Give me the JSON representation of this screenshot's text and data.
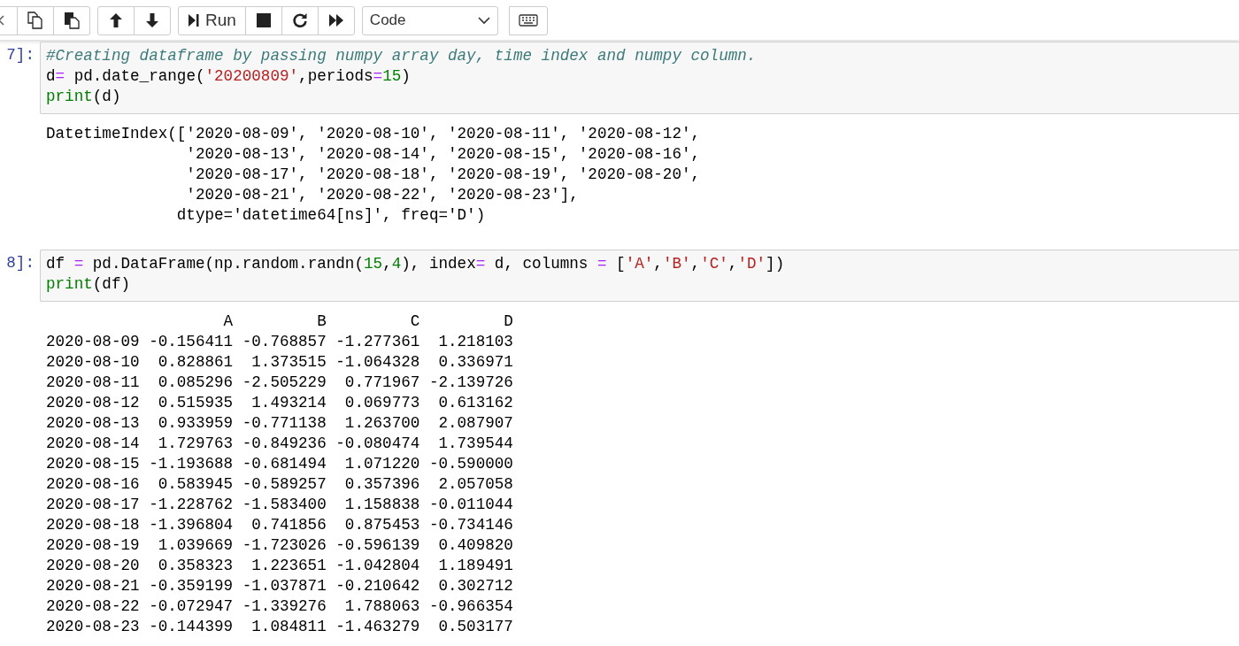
{
  "toolbar": {
    "groups": [
      [
        {
          "kind": "collapse"
        },
        {
          "kind": "copy"
        },
        {
          "kind": "paste"
        }
      ],
      [
        {
          "kind": "up"
        },
        {
          "kind": "down"
        }
      ],
      [
        {
          "kind": "run",
          "label": "Run"
        },
        {
          "kind": "stop"
        },
        {
          "kind": "restart"
        },
        {
          "kind": "fast-forward"
        }
      ]
    ],
    "cell_type": "Code",
    "extra": [
      {
        "kind": "keyboard"
      }
    ]
  },
  "cells": [
    {
      "prompt": "7]:",
      "code": [
        [
          {
            "kind": "comment",
            "text": "#Creating dataframe by passing numpy array day, time index and numpy column."
          }
        ],
        [
          {
            "kind": "plain",
            "text": "d"
          },
          {
            "kind": "op",
            "text": "="
          },
          {
            "kind": "plain",
            "text": " pd.date_range("
          },
          {
            "kind": "string",
            "text": "'20200809'"
          },
          {
            "kind": "plain",
            "text": ",periods"
          },
          {
            "kind": "op",
            "text": "="
          },
          {
            "kind": "number",
            "text": "15"
          },
          {
            "kind": "plain",
            "text": ")"
          }
        ],
        [
          {
            "kind": "builtin",
            "text": "print"
          },
          {
            "kind": "plain",
            "text": "(d)"
          }
        ]
      ],
      "output": [
        "DatetimeIndex(['2020-08-09', '2020-08-10', '2020-08-11', '2020-08-12',",
        "               '2020-08-13', '2020-08-14', '2020-08-15', '2020-08-16',",
        "               '2020-08-17', '2020-08-18', '2020-08-19', '2020-08-20',",
        "               '2020-08-21', '2020-08-22', '2020-08-23'],",
        "              dtype='datetime64[ns]', freq='D')"
      ]
    },
    {
      "prompt": "8]:",
      "code": [
        [
          {
            "kind": "plain",
            "text": "df "
          },
          {
            "kind": "op",
            "text": "="
          },
          {
            "kind": "plain",
            "text": " pd.DataFrame(np.random.randn("
          },
          {
            "kind": "number",
            "text": "15"
          },
          {
            "kind": "plain",
            "text": ","
          },
          {
            "kind": "number",
            "text": "4"
          },
          {
            "kind": "plain",
            "text": "), index"
          },
          {
            "kind": "op",
            "text": "="
          },
          {
            "kind": "plain",
            "text": " d, columns "
          },
          {
            "kind": "op",
            "text": "="
          },
          {
            "kind": "plain",
            "text": " ["
          },
          {
            "kind": "string",
            "text": "'A'"
          },
          {
            "kind": "plain",
            "text": ","
          },
          {
            "kind": "string",
            "text": "'B'"
          },
          {
            "kind": "plain",
            "text": ","
          },
          {
            "kind": "string",
            "text": "'C'"
          },
          {
            "kind": "plain",
            "text": ","
          },
          {
            "kind": "string",
            "text": "'D'"
          },
          {
            "kind": "plain",
            "text": "])"
          }
        ],
        [
          {
            "kind": "builtin",
            "text": "print"
          },
          {
            "kind": "plain",
            "text": "(df)"
          }
        ]
      ],
      "output": [
        "                   A         B         C         D",
        "2020-08-09 -0.156411 -0.768857 -1.277361  1.218103",
        "2020-08-10  0.828861  1.373515 -1.064328  0.336971",
        "2020-08-11  0.085296 -2.505229  0.771967 -2.139726",
        "2020-08-12  0.515935  1.493214  0.069773  0.613162",
        "2020-08-13  0.933959 -0.771138  1.263700  2.087907",
        "2020-08-14  1.729763 -0.849236 -0.080474  1.739544",
        "2020-08-15 -1.193688 -0.681494  1.071220 -0.590000",
        "2020-08-16  0.583945 -0.589257  0.357396  2.057058",
        "2020-08-17 -1.228762 -1.583400  1.158838 -0.011044",
        "2020-08-18 -1.396804  0.741856  0.875453 -0.734146",
        "2020-08-19  1.039669 -1.723026 -0.596139  0.409820",
        "2020-08-20  0.358323  1.223651 -1.042804  1.189491",
        "2020-08-21 -0.359199 -1.037871 -0.210642  0.302712",
        "2020-08-22 -0.072947 -1.339276  1.788063 -0.966354",
        "2020-08-23 -0.144399  1.084811 -1.463279  0.503177"
      ]
    }
  ]
}
